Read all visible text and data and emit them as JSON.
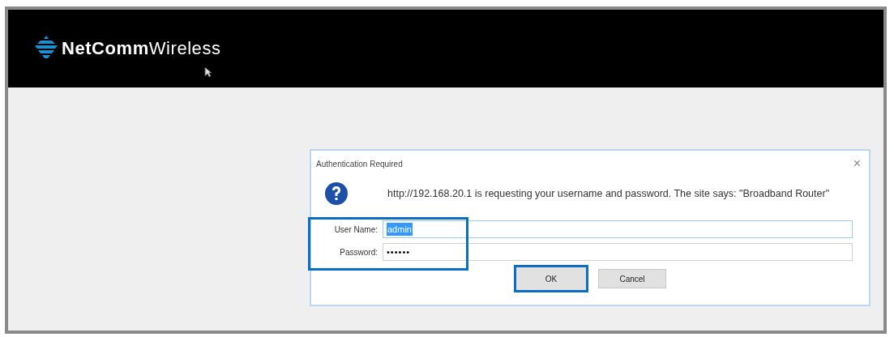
{
  "header": {
    "logo": "**NetComm**Wireless"
  },
  "dialog": {
    "title": "Authentication Required",
    "close": "×",
    "message": "http://192.168.20.1 is requesting your username and password. The site says: \"Broadband Router\"",
    "credentials_highlighted": true,
    "fields": [
      {
        "label": "User Name:",
        "value": "admin",
        "text_selected": true
      },
      {
        "label": "Password:",
        "value": "••••••",
        "text_selected": false
      }
    ],
    "buttons": [
      {
        "label": "OK",
        "highlighted": true
      },
      {
        "label": "Cancel",
        "highlighted": false
      }
    ]
  }
}
